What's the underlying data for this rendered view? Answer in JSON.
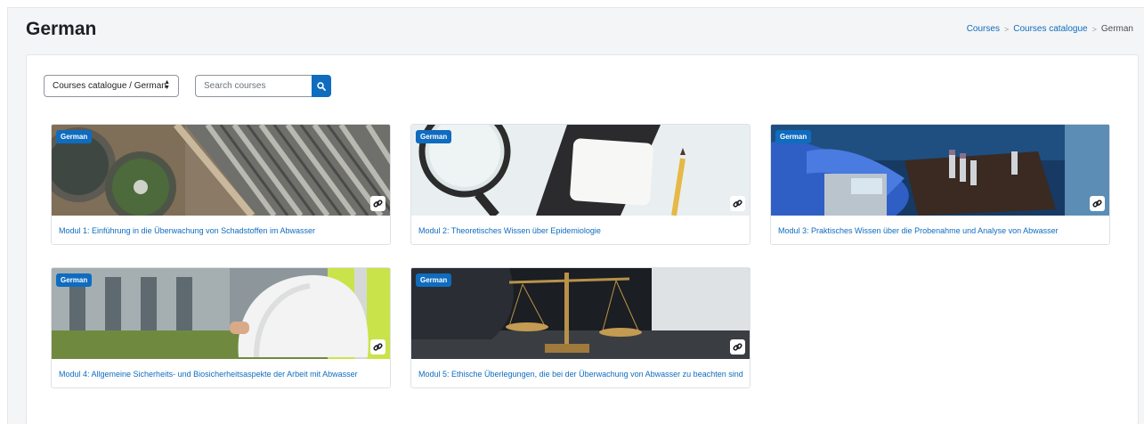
{
  "header": {
    "title": "German",
    "breadcrumb": [
      "Courses",
      "Courses catalogue",
      "German"
    ]
  },
  "filters": {
    "category_value": "Courses catalogue / German",
    "search_placeholder": "Search courses"
  },
  "colors": {
    "accent": "#0f6cbf"
  },
  "courses": [
    {
      "badge": "German",
      "title": "Modul 1: Einführung in die Überwachung von Schadstoffen im Abwasser",
      "icon": "link-icon"
    },
    {
      "badge": "German",
      "title": "Modul 2: Theoretisches Wissen über Epidemiologie",
      "icon": "link-icon"
    },
    {
      "badge": "German",
      "title": "Modul 3: Praktisches Wissen über die Probenahme und Analyse von Abwasser",
      "icon": "link-icon"
    },
    {
      "badge": "German",
      "title": "Modul 4: Allgemeine Sicherheits- und Biosicherheitsaspekte der Arbeit mit Abwasser",
      "icon": "link-icon"
    },
    {
      "badge": "German",
      "title": "Modul 5: Ethische Überlegungen, die bei der Überwachung von Abwasser zu beachten sind",
      "icon": "link-icon"
    }
  ]
}
